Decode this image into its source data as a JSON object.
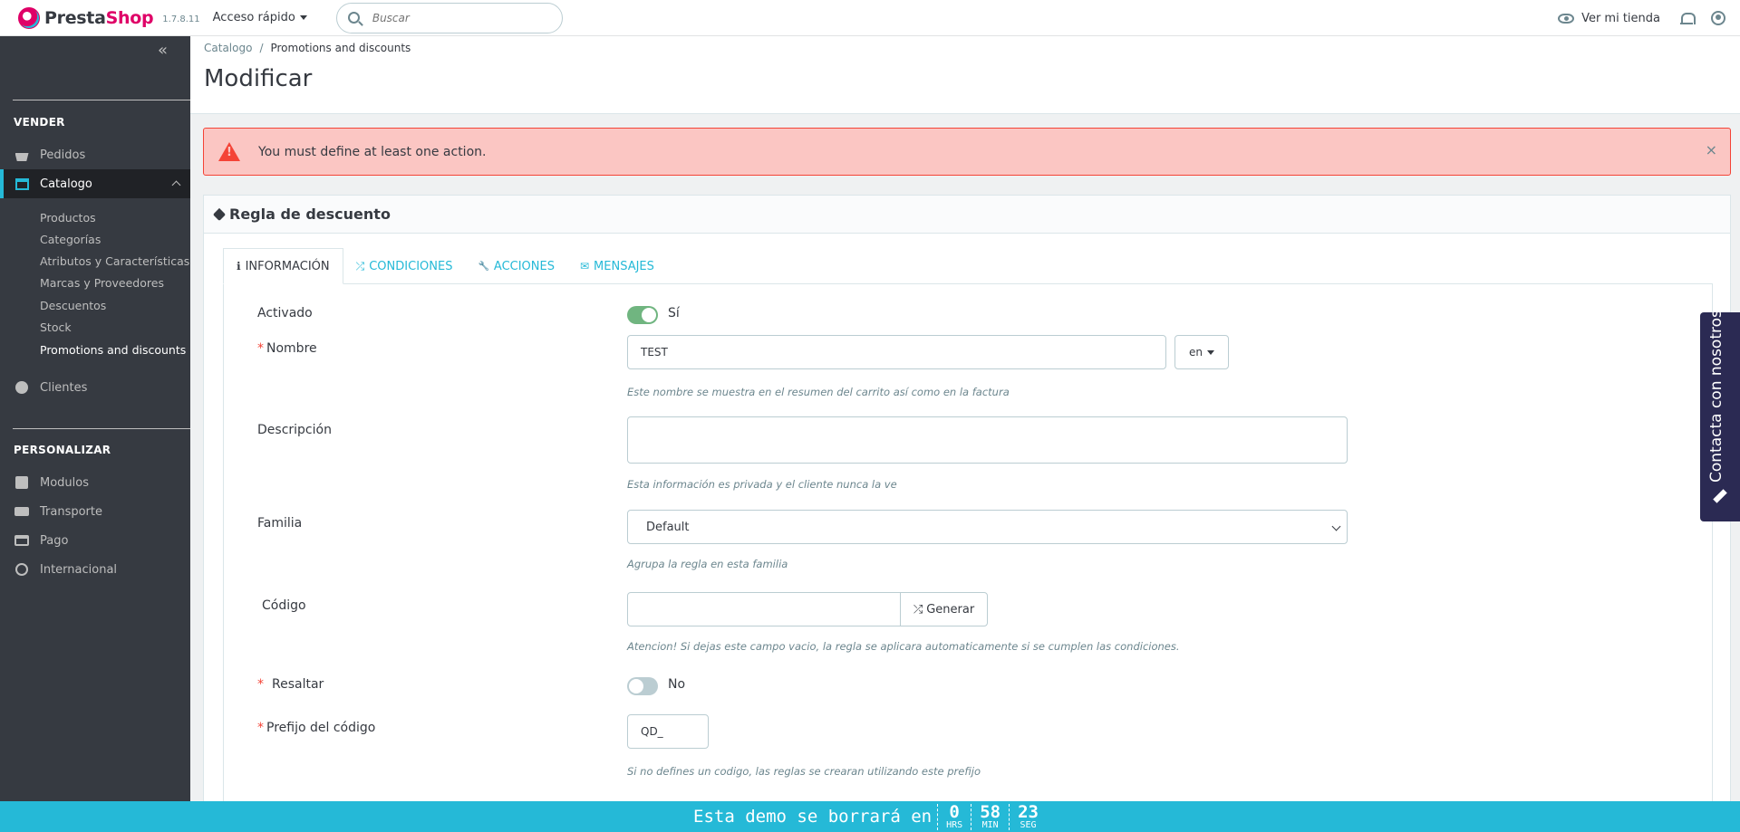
{
  "header": {
    "logo_presta": "Presta",
    "logo_shop": "Shop",
    "version": "1.7.8.11",
    "quick_access": "Acceso rápido",
    "search_placeholder": "Buscar",
    "view_store": "Ver mi tienda"
  },
  "sidebar": {
    "collapse_glyph": "«",
    "section_sell": "VENDER",
    "section_customize": "PERSONALIZAR",
    "items": [
      {
        "label": "Pedidos",
        "icon": "basket-icon"
      },
      {
        "label": "Catalogo",
        "icon": "store-icon",
        "active": true
      },
      {
        "label": "Clientes",
        "icon": "user-circle-icon"
      },
      {
        "label": "Modulos",
        "icon": "puzzle-icon"
      },
      {
        "label": "Transporte",
        "icon": "truck-icon"
      },
      {
        "label": "Pago",
        "icon": "credit-card-icon"
      },
      {
        "label": "Internacional",
        "icon": "globe-icon"
      }
    ],
    "catalog_sub": [
      "Productos",
      "Categorías",
      "Atributos y Características",
      "Marcas y Proveedores",
      "Descuentos",
      "Stock",
      "Promotions and discounts"
    ]
  },
  "breadcrumb": {
    "parent": "Catalogo",
    "separator": "/",
    "current": "Promotions and discounts"
  },
  "page_title": "Modificar",
  "alert": {
    "message": "You must define at least one action.",
    "close": "×"
  },
  "panel": {
    "title": "Regla de descuento",
    "tabs": [
      {
        "label": "INFORMACIÓN",
        "icon": "info-icon",
        "glyph": "ℹ"
      },
      {
        "label": "CONDICIONES",
        "icon": "random-icon",
        "glyph": "⤮"
      },
      {
        "label": "ACCIONES",
        "icon": "wrench-icon",
        "glyph": "🔧"
      },
      {
        "label": "MENSAJES",
        "icon": "envelope-icon",
        "glyph": "✉"
      }
    ]
  },
  "form": {
    "activado_label": "Activado",
    "activado_value": "Sí",
    "nombre_label": "Nombre",
    "nombre_value": "TEST",
    "lang": "en",
    "nombre_help": "Este nombre se muestra en el resumen del carrito así como en la factura",
    "descripcion_label": "Descripción",
    "descripcion_value": "",
    "descripcion_help": "Esta información es privada y el cliente nunca la ve",
    "familia_label": "Familia",
    "familia_value": "Default",
    "familia_help": "Agrupa la regla en esta familia",
    "codigo_label": "Código",
    "codigo_value": "",
    "generar": "Generar",
    "codigo_help": "Atencion! Si dejas este campo vacio, la regla se aplicara automaticamente si se cumplen las condiciones.",
    "resaltar_label": "Resaltar",
    "resaltar_value": "No",
    "prefijo_label": "Prefijo del código",
    "prefijo_value": "QD_",
    "prefijo_help": "Si no defines un codigo, las reglas se crearan utilizando este prefijo",
    "required_mark": "*"
  },
  "contact_tab": "Contacta con nosotros",
  "countdown": {
    "text": "Esta demo se borrará en",
    "hours": "0",
    "hours_label": "HRS",
    "minutes": "58",
    "minutes_label": "MIN",
    "seconds": "23",
    "seconds_label": "SEG"
  },
  "colors": {
    "accent": "#25b9d7",
    "brand_pink": "#df0067",
    "sidebar_bg": "#363a41",
    "alert_bg": "#fbc6c3",
    "switch_on": "#70b580",
    "contact_bg": "#2b2a53"
  }
}
